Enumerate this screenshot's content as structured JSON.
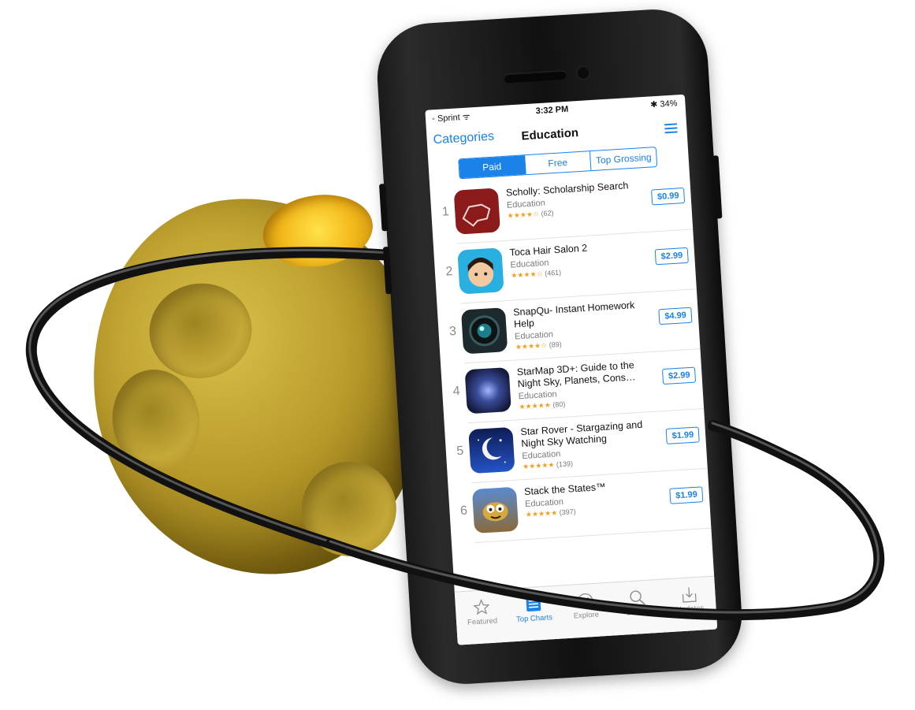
{
  "status": {
    "carrier": "◦ Sprint ᯤ",
    "time": "3:32 PM",
    "battery": "✱ 34%"
  },
  "nav": {
    "back_label": "Categories",
    "title": "Education"
  },
  "segments": [
    {
      "label": "Paid",
      "active": true
    },
    {
      "label": "Free",
      "active": false
    },
    {
      "label": "Top Grossing",
      "active": false
    }
  ],
  "apps": [
    {
      "rank": "1",
      "name": "Scholly: Scholarship Search",
      "category": "Education",
      "stars": "★★★★☆",
      "ratings": "(62)",
      "price": "$0.99",
      "icon": "scholly-icon",
      "icon_color": "#8b1a1a"
    },
    {
      "rank": "2",
      "name": "Toca Hair Salon 2",
      "category": "Education",
      "stars": "★★★★☆",
      "ratings": "(461)",
      "price": "$2.99",
      "icon": "toca-hair-icon",
      "icon_color": "#2ab0e0"
    },
    {
      "rank": "3",
      "name": "SnapQu- Instant Homework Help",
      "category": "Education",
      "stars": "★★★★☆",
      "ratings": "(89)",
      "price": "$4.99",
      "icon": "snapqu-camera-icon",
      "icon_color": "#1c2a2e"
    },
    {
      "rank": "4",
      "name": "StarMap 3D+: Guide to the Night Sky, Planets, Cons…",
      "category": "Education",
      "stars": "★★★★★",
      "ratings": "(80)",
      "price": "$2.99",
      "icon": "starmap-galaxy-icon",
      "icon_color": "#1b2452"
    },
    {
      "rank": "5",
      "name": "Star Rover - Stargazing and Night Sky Watching",
      "category": "Education",
      "stars": "★★★★★",
      "ratings": "(139)",
      "price": "$1.99",
      "icon": "star-rover-moon-icon",
      "icon_color": "#1d3e9a"
    },
    {
      "rank": "6",
      "name": "Stack the States™",
      "category": "Education",
      "stars": "★★★★★",
      "ratings": "(397)",
      "price": "$1.99",
      "icon": "stack-the-states-icon",
      "icon_color": "#4a7cc0"
    }
  ],
  "tabs": [
    {
      "label": "Featured",
      "icon": "star-icon"
    },
    {
      "label": "Top Charts",
      "icon": "list-icon",
      "active": true
    },
    {
      "label": "Explore",
      "icon": "compass-icon"
    },
    {
      "label": "Search",
      "icon": "search-icon"
    },
    {
      "label": "Updates",
      "icon": "download-tray-icon"
    }
  ],
  "colors": {
    "accent": "#1a82e8",
    "planet": "#b89a2a",
    "phone": "#111111"
  }
}
